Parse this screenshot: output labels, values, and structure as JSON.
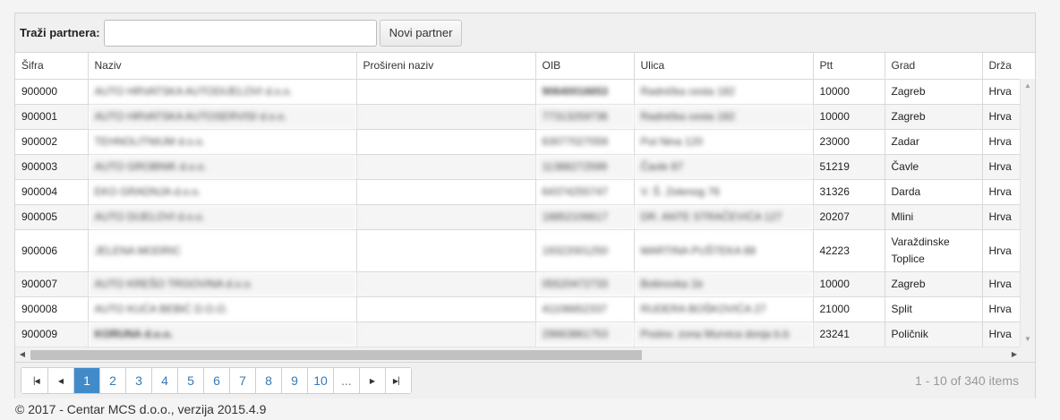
{
  "toolbar": {
    "search_label": "Traži partnera:",
    "search_value": "",
    "new_partner_label": "Novi partner"
  },
  "grid": {
    "columns": [
      "Šifra",
      "Naziv",
      "Prošireni naziv",
      "OIB",
      "Ulica",
      "Ptt",
      "Grad",
      "Drža"
    ],
    "rows": [
      {
        "sifra": "900000",
        "naziv": "AUTO HRVATSKA AUTODIJELOVI d.o.o.",
        "prosireni": "",
        "oib": "90640016653",
        "ulica": "Radnička cesta 182",
        "ptt": "10000",
        "grad": "Zagreb",
        "drzava": "Hrva"
      },
      {
        "sifra": "900001",
        "naziv": "AUTO HRVATSKA AUTOSERVISI d.o.o.",
        "prosireni": "",
        "oib": "77313259736",
        "ulica": "Radnička cesta 182",
        "ptt": "10000",
        "grad": "Zagreb",
        "drzava": "Hrva"
      },
      {
        "sifra": "900002",
        "naziv": "TEHNOLITNIUM d.o.o.",
        "prosireni": "",
        "oib": "63077027059",
        "ulica": "Put Nina 120",
        "ptt": "23000",
        "grad": "Zadar",
        "drzava": "Hrva"
      },
      {
        "sifra": "900003",
        "naziv": "AUTO GROBNIK d.o.o.",
        "prosireni": "",
        "oib": "11388272599",
        "ulica": "Čavle 87",
        "ptt": "51219",
        "grad": "Čavle",
        "drzava": "Hrva"
      },
      {
        "sifra": "900004",
        "naziv": "EKO GRADNJA d.o.o.",
        "prosireni": "",
        "oib": "64374255747",
        "ulica": "V. Š. Zelenog 76",
        "ptt": "31326",
        "grad": "Darda",
        "drzava": "Hrva"
      },
      {
        "sifra": "900005",
        "naziv": "AUTO DIJELOVI d.o.o.",
        "prosireni": "",
        "oib": "18852106617",
        "ulica": "DR. ANTE STRAČEVIĆA 127",
        "ptt": "20207",
        "grad": "Mlini",
        "drzava": "Hrva"
      },
      {
        "sifra": "900006",
        "naziv": "JELENA MODRIC",
        "prosireni": "",
        "oib": "19322001250",
        "ulica": "MARTINA PUŠTEKA 88",
        "ptt": "42223",
        "grad": "Varaždinske Toplice",
        "drzava": "Hrva"
      },
      {
        "sifra": "900007",
        "naziv": "AUTO KREŠO TRGOVINA d.o.o.",
        "prosireni": "",
        "oib": "05520472733",
        "ulica": "Botinovka 1b",
        "ptt": "10000",
        "grad": "Zagreb",
        "drzava": "Hrva"
      },
      {
        "sifra": "900008",
        "naziv": "AUTO KUĆA BEBIĆ D.O.O.",
        "prosireni": "",
        "oib": "41106652337",
        "ulica": "RUDERA BOŠKOVIĆA 27",
        "ptt": "21000",
        "grad": "Split",
        "drzava": "Hrva"
      },
      {
        "sifra": "900009",
        "naziv": "KORUNA d.o.o.",
        "prosireni": "",
        "oib": "29663861753",
        "ulica": "Poslov. zona Murvica donja b.b",
        "ptt": "23241",
        "grad": "Poličnik",
        "drzava": "Hrva"
      }
    ]
  },
  "pager": {
    "first_icon": "first-page-icon",
    "prev_icon": "prev-page-icon",
    "next_icon": "next-page-icon",
    "last_icon": "last-page-icon",
    "pages": [
      "1",
      "2",
      "3",
      "4",
      "5",
      "6",
      "7",
      "8",
      "9",
      "10",
      "..."
    ],
    "active_page": "1",
    "info": "1 - 10 of 340 items"
  },
  "footer": {
    "text": "© 2017 - Centar MCS d.o.o., verzija 2015.4.9"
  },
  "colors": {
    "accent": "#428bca",
    "link": "#337ab7",
    "toolbar_bg": "#f0f0f0"
  }
}
